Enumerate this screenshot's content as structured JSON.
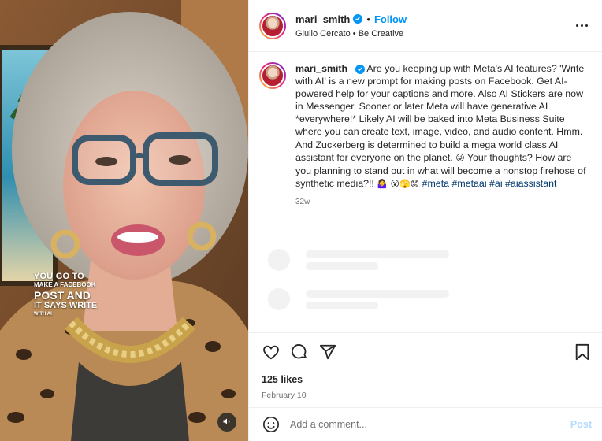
{
  "post": {
    "username": "mari_smith",
    "follow_label": "Follow",
    "separator": "•",
    "audio_artist": "Giulio Cercato",
    "audio_track": "Be Creative",
    "caption_parts": [
      "Are you keeping up with Meta's AI features? 'Write with AI' is a new prompt for making posts on Facebook. Get AI-powered help for your captions and more. Also AI Stickers are now in Messenger. Sooner or later Meta will have generative AI *everywhere!* Likely AI will be baked into Meta Business Suite where you can create text, image, video, and audio content. Hmm. And Zuckerberg is determined to build a mega world class AI assistant for everyone on the planet. ",
      " Your thoughts? How are you planning to stand out in what will become a nonstop firehose of synthetic media?!! "
    ],
    "emoji_wink": "😜",
    "emoji_group": "🤷‍♀️ 😮🫣😟",
    "hashtags": [
      "#meta",
      "#metaai",
      "#ai",
      "#aiassistant"
    ],
    "time_ago": "32w",
    "likes": "125 likes",
    "date": "February 10",
    "comment_placeholder": "Add a comment...",
    "post_label": "Post"
  },
  "media": {
    "overlay_lines": [
      "YOU GO TO",
      "MAKE A FACEBOOK",
      "POST AND",
      "IT SAYS WRITE",
      "WITH AI"
    ]
  },
  "icons": {
    "verified": "verified-badge-icon",
    "more": "more-options-icon",
    "like": "heart-icon",
    "comment": "comment-bubble-icon",
    "share": "paper-plane-icon",
    "save": "bookmark-icon",
    "emoji": "smiley-icon",
    "mute": "speaker-icon"
  },
  "colors": {
    "link_blue": "#0095f6",
    "hashtag_blue": "#00376b",
    "post_disabled": "#b3dbff",
    "muted_text": "#737373"
  }
}
